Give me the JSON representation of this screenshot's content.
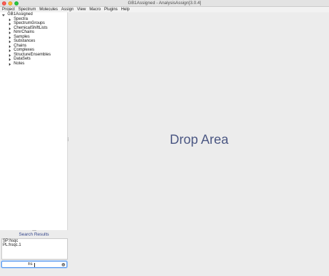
{
  "window": {
    "title": "GB1Assigned - AnalysisAssign[3.0.4]"
  },
  "menubar": {
    "items": [
      "Project",
      "Spectrum",
      "Molecules",
      "Assign",
      "View",
      "Macro",
      "Plugins",
      "Help"
    ]
  },
  "sidebar": {
    "root": "GB1Assigned",
    "items": [
      "Spectra",
      "SpectrumGroups",
      "ChemicalShiftLists",
      "NmrChains",
      "Samples",
      "Substances",
      "Chains",
      "Complexes",
      "StructureEnsembles",
      "DataSets",
      "Notes"
    ]
  },
  "drop_area": {
    "label": "Drop Area"
  },
  "search": {
    "title": "Search Results",
    "results": [
      "SP:hsqc",
      "PL:hsqc.1"
    ],
    "query": "hs"
  },
  "icons": {
    "clear": "clear-icon",
    "expand": "chevron-right-icon",
    "collapse": "chevron-down-icon"
  },
  "colors": {
    "accent": "#4b5783",
    "search_title": "#33458a",
    "focus_ring": "#5b9bf0"
  }
}
